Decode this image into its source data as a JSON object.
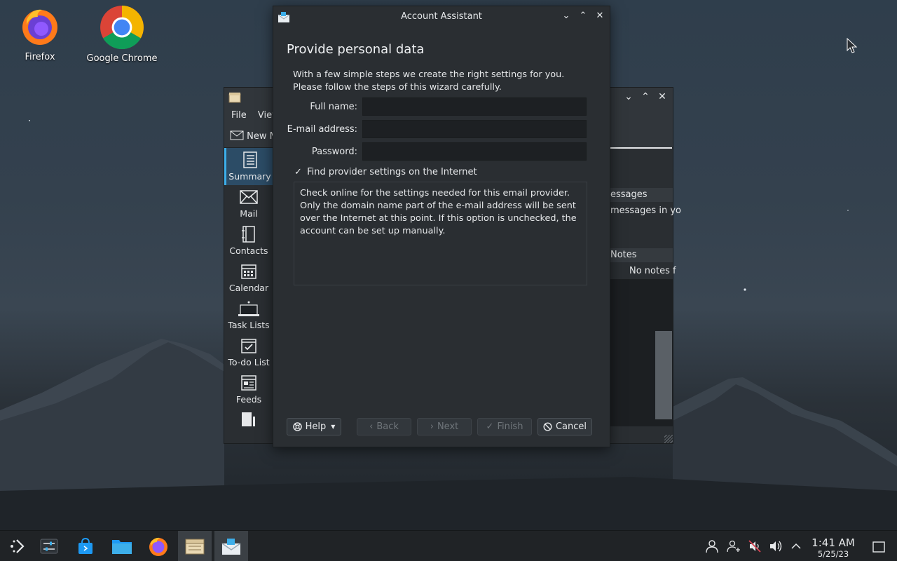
{
  "desktop": {
    "icons": [
      {
        "label": "Firefox"
      },
      {
        "label": "Google Chrome"
      }
    ]
  },
  "kontact": {
    "menu": [
      "File",
      "View"
    ],
    "toolbar": {
      "new_message": "New M"
    },
    "sidebar": [
      {
        "label": "Summary",
        "icon": "summary-icon"
      },
      {
        "label": "Mail",
        "icon": "mail-icon"
      },
      {
        "label": "Contacts",
        "icon": "contacts-icon"
      },
      {
        "label": "Calendar",
        "icon": "calendar-icon"
      },
      {
        "label": "Task Lists",
        "icon": "task-lists-icon"
      },
      {
        "label": "To-do List",
        "icon": "todo-icon"
      },
      {
        "label": "Feeds",
        "icon": "feeds-icon"
      }
    ],
    "right": {
      "messages_header": "essages",
      "messages_text": "messages in yo",
      "notes_header": "Notes",
      "notes_text": "No notes f"
    }
  },
  "dialog": {
    "title": "Account Assistant",
    "heading": "Provide personal data",
    "intro": "With a few simple steps we create the right settings for you. Please follow the steps of this wizard carefully.",
    "fields": {
      "full_name_label": "Full name:",
      "full_name_value": "",
      "email_label": "E-mail address:",
      "email_value": "",
      "password_label": "Password:",
      "password_value": ""
    },
    "checkbox": {
      "checked": true,
      "label": "Find provider settings on the Internet"
    },
    "info": "Check online for the settings needed for this email provider. Only the domain name part of the e-mail address will be sent over the Internet at this point. If this option is unchecked, the account can be set up manually.",
    "buttons": {
      "help": "Help",
      "back": "Back",
      "next": "Next",
      "finish": "Finish",
      "cancel": "Cancel"
    }
  },
  "taskbar": {
    "clock_time": "1:41 AM",
    "clock_date": "5/25/23"
  },
  "colors": {
    "accent": "#3daee9",
    "window_bg": "#2a2e32",
    "taskbar_bg": "#202326"
  }
}
